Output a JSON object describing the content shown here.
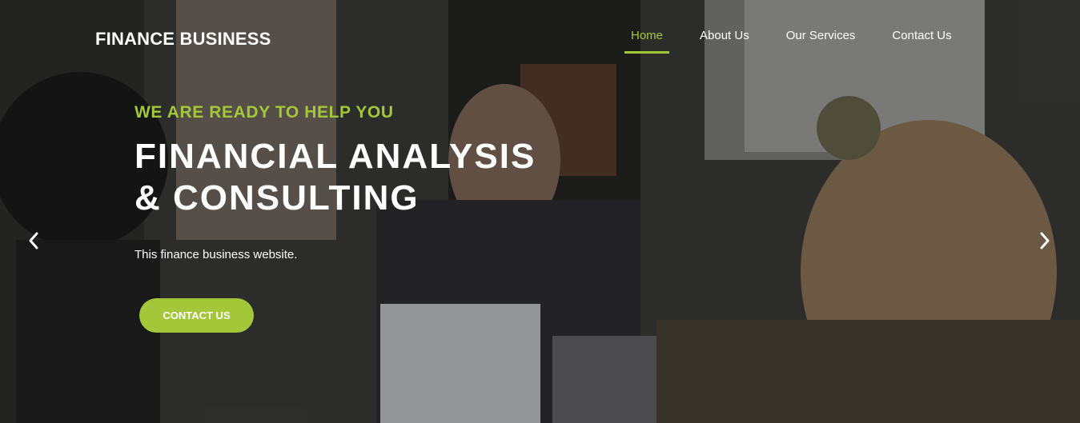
{
  "header": {
    "brand": "FINANCE BUSINESS",
    "nav": [
      {
        "label": "Home",
        "active": true
      },
      {
        "label": "About Us",
        "active": false
      },
      {
        "label": "Our Services",
        "active": false
      },
      {
        "label": "Contact Us",
        "active": false
      }
    ]
  },
  "hero": {
    "kicker": "WE ARE READY TO HELP YOU",
    "headline_line1": "FINANCIAL ANALYSIS",
    "headline_line2": "& CONSULTING",
    "description": "This finance business website.",
    "cta_label": "CONTACT US"
  },
  "carousel": {
    "prev_icon": "chevron-left-icon",
    "next_icon": "chevron-right-icon"
  },
  "colors": {
    "accent": "#a4c639",
    "text": "#ffffff",
    "overlay": "#1a1a1a"
  }
}
